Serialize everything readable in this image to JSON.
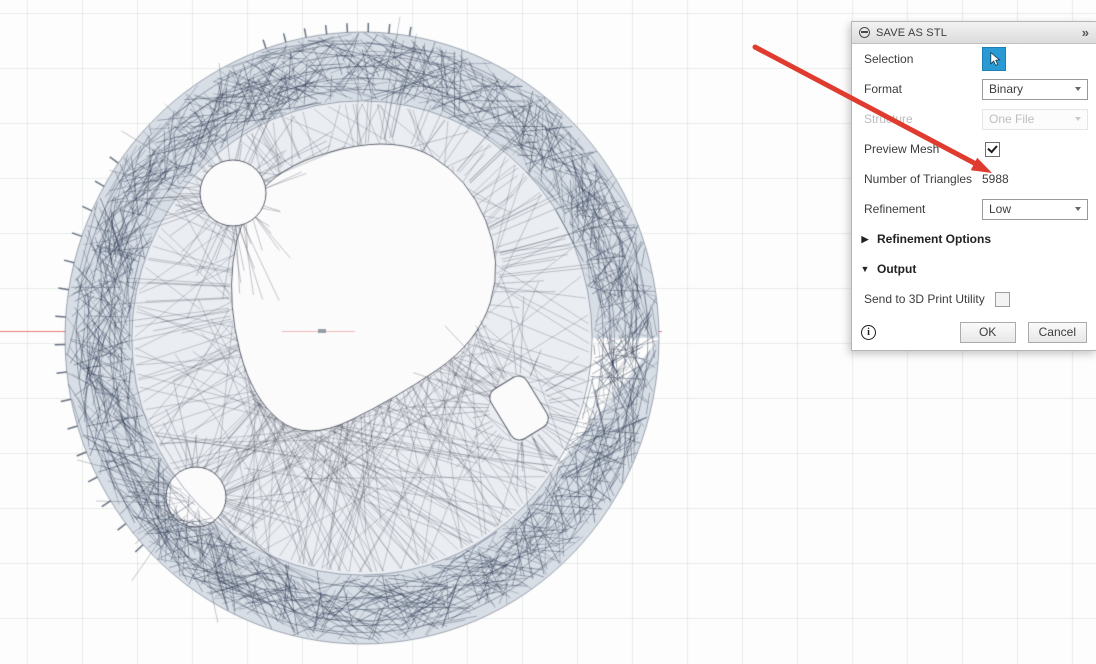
{
  "colors": {
    "accent_blue": "#2a9ad4",
    "annotation_red": "#df3b2f",
    "mesh_wire": "#28364e",
    "axis_red": "#e1695f"
  },
  "icons": {
    "panel_expand_glyph": "»",
    "section_collapsed_glyph": "▶",
    "section_expanded_glyph": "▼",
    "info_glyph": "i"
  },
  "dialog": {
    "title": "SAVE AS STL",
    "fields": {
      "selection": {
        "label": "Selection"
      },
      "format": {
        "label": "Format",
        "value": "Binary"
      },
      "structure": {
        "label": "Structure",
        "value": "One File",
        "disabled": true
      },
      "preview_mesh": {
        "label": "Preview Mesh",
        "checked": true
      },
      "number_of_triangles": {
        "label": "Number of Triangles",
        "value": "5988"
      },
      "refinement": {
        "label": "Refinement",
        "value": "Low"
      }
    },
    "sections": {
      "refinement_options": {
        "label": "Refinement Options",
        "expanded": false
      },
      "output": {
        "label": "Output",
        "expanded": true
      }
    },
    "send_to_3d": {
      "label": "Send to 3D Print Utility",
      "checked": false
    },
    "footer": {
      "ok": "OK",
      "cancel": "Cancel"
    }
  }
}
